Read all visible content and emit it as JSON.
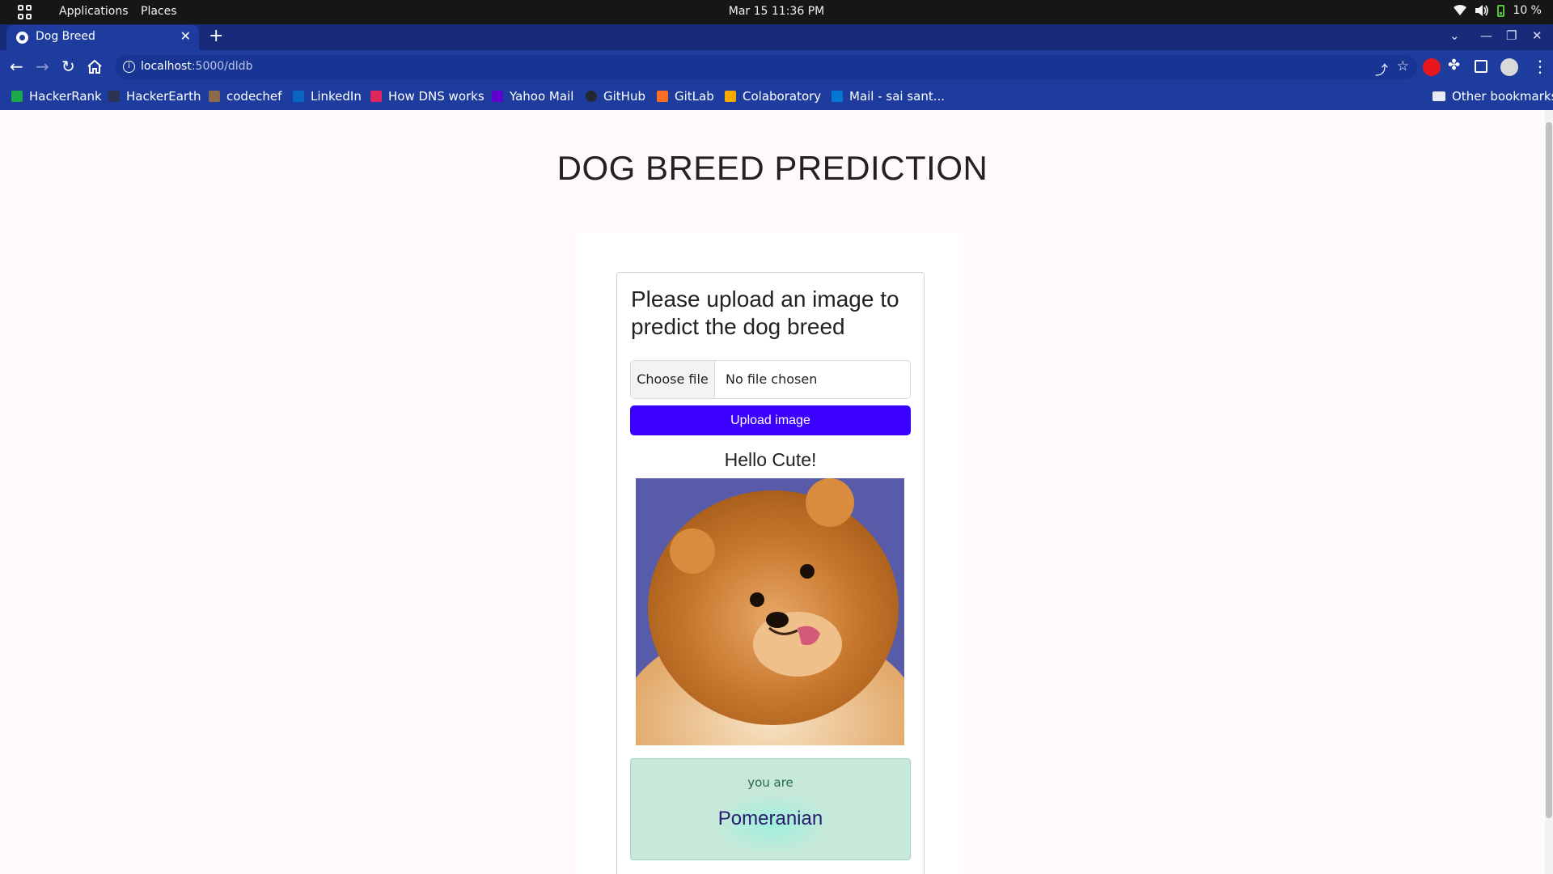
{
  "system_bar": {
    "menu_applications": "Applications",
    "menu_places": "Places",
    "clock": "Mar 15  11:36 PM",
    "battery": "10 %"
  },
  "browser": {
    "tab_title": "Dog Breed",
    "url_host": "localhost",
    "url_path": ":5000/dldb",
    "bookmarks": [
      {
        "label": "HackerRank",
        "color": "#1ba94c"
      },
      {
        "label": "HackerEarth",
        "color": "#2c3454"
      },
      {
        "label": "codechef",
        "color": "#8a6a4a"
      },
      {
        "label": "LinkedIn",
        "color": "#0a66c2"
      },
      {
        "label": "How DNS works",
        "color": "#e0245e"
      },
      {
        "label": "Yahoo Mail",
        "color": "#6001d2"
      },
      {
        "label": "GitHub",
        "color": "#24292f"
      },
      {
        "label": "GitLab",
        "color": "#fc6d26"
      },
      {
        "label": "Colaboratory",
        "color": "#f9ab00"
      },
      {
        "label": "Mail - sai sant...",
        "color": "#0078d4"
      }
    ],
    "other_bookmarks": "Other bookmarks"
  },
  "page": {
    "title": "DOG BREED PREDICTION",
    "card_heading": "Please upload an image to predict the dog breed",
    "choose_file_label": "Choose file",
    "file_status": "No file chosen",
    "upload_button": "Upload image",
    "greeting": "Hello Cute!",
    "result_lead": "you are",
    "result_breed": "Pomeranian"
  },
  "colors": {
    "chrome_bg": "#1d3c9e",
    "upload_button": "#3b00ff",
    "result_bg": "#c8e9da"
  }
}
